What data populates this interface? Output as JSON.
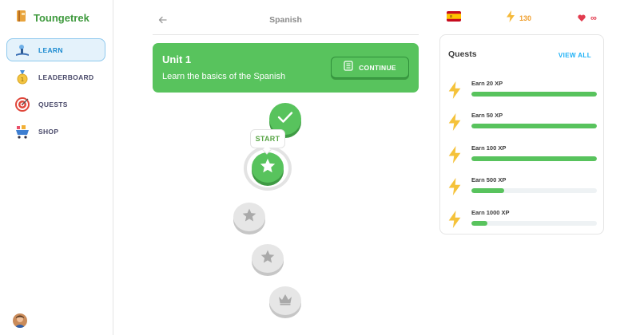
{
  "app": {
    "name": "Toungetrek"
  },
  "sidebar": {
    "items": [
      {
        "label": "LEARN",
        "icon": "learn-icon",
        "active": true
      },
      {
        "label": "LEADERBOARD",
        "icon": "medal-icon",
        "active": false
      },
      {
        "label": "QUESTS",
        "icon": "target-icon",
        "active": false
      },
      {
        "label": "SHOP",
        "icon": "cart-icon",
        "active": false
      }
    ]
  },
  "header": {
    "title": "Spanish",
    "back_icon": "arrow-left-icon"
  },
  "unit": {
    "title": "Unit 1",
    "subtitle": "Learn the basics of the Spanish",
    "continue_label": "CONTINUE",
    "continue_icon": "notebook-icon"
  },
  "path": {
    "start_label": "START",
    "nodes": [
      {
        "state": "done",
        "icon": "check-icon"
      },
      {
        "state": "current",
        "icon": "star-icon"
      },
      {
        "state": "locked",
        "icon": "star-icon"
      },
      {
        "state": "locked",
        "icon": "star-icon"
      },
      {
        "state": "locked",
        "icon": "crown-icon"
      }
    ]
  },
  "stats": {
    "flag": "spain-flag-icon",
    "xp": "130",
    "hearts": "∞"
  },
  "quests": {
    "title": "Quests",
    "view_all": "VIEW ALL",
    "items": [
      {
        "label": "Earn 20 XP",
        "progress": 1.0
      },
      {
        "label": "Earn 50 XP",
        "progress": 1.0
      },
      {
        "label": "Earn 100 XP",
        "progress": 1.0
      },
      {
        "label": "Earn 500 XP",
        "progress": 0.26
      },
      {
        "label": "Earn 1000 XP",
        "progress": 0.13
      }
    ]
  },
  "colors": {
    "primary_green": "#58c35d",
    "accent_blue": "#1cb0f6",
    "xp_orange": "#f0a030",
    "heart_red": "#e23c4f"
  }
}
